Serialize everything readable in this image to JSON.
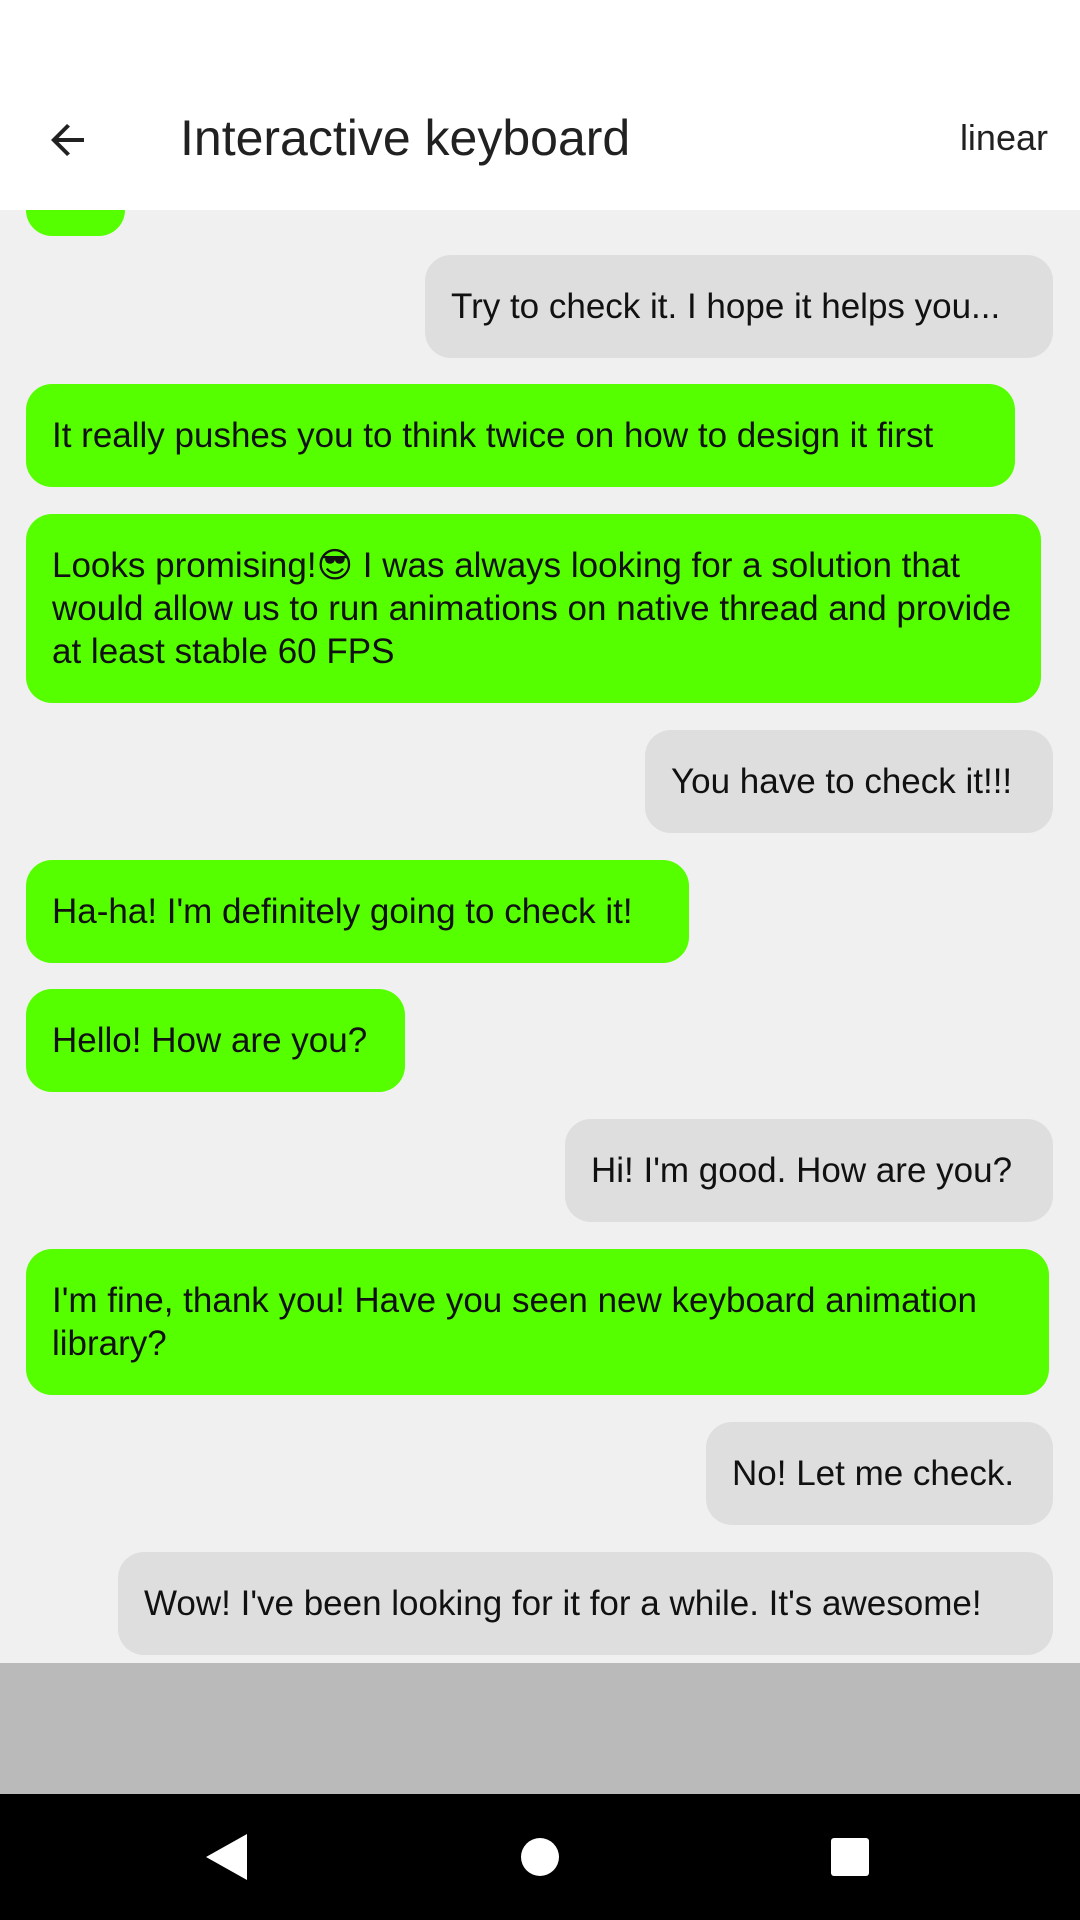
{
  "app_bar": {
    "title": "Interactive keyboard",
    "action_label": "linear",
    "back_icon": "arrow-left-icon"
  },
  "colors": {
    "received_bubble": "#55ff00",
    "sent_bubble": "#dedede",
    "chat_background": "#f0f0f0",
    "keyboard_placeholder": "#bababa"
  },
  "messages": [
    {
      "sender": "received",
      "text": ""
    },
    {
      "sender": "sent",
      "text": "Try to check it. I hope it helps you..."
    },
    {
      "sender": "received",
      "text": "It really pushes you to think twice on how to design it first"
    },
    {
      "sender": "received",
      "text": "Looks promising!😎 I was always looking for a solution that would allow us to run animations on native thread and provide at least stable 60 FPS"
    },
    {
      "sender": "sent",
      "text": "You have to check it!!!"
    },
    {
      "sender": "received",
      "text": "Ha-ha! I'm definitely going to check it!"
    },
    {
      "sender": "received",
      "text": "Hello! How are you?"
    },
    {
      "sender": "sent",
      "text": "Hi! I'm good. How are you?"
    },
    {
      "sender": "received",
      "text": "I'm fine, thank you! Have you seen new keyboard animation library?"
    },
    {
      "sender": "sent",
      "text": "No! Let me check."
    },
    {
      "sender": "sent",
      "text": "Wow! I've been looking for it for a while. It's awesome!"
    }
  ],
  "nav_bar": {
    "back_icon": "triangle-back-icon",
    "home_icon": "circle-home-icon",
    "recents_icon": "square-recents-icon"
  }
}
